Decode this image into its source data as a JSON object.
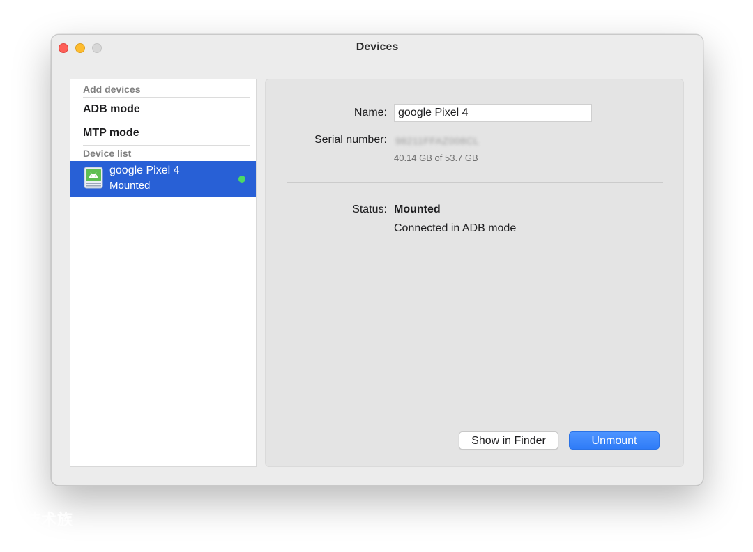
{
  "window": {
    "title": "Devices"
  },
  "sidebar": {
    "add_devices_header": "Add devices",
    "adb_mode_label": "ADB mode",
    "mtp_mode_label": "MTP mode",
    "device_list_header": "Device list",
    "devices": [
      {
        "name": "google Pixel 4",
        "status": "Mounted",
        "icon": "android-drive-icon",
        "online_color": "#4cd964",
        "selected": true
      }
    ]
  },
  "details": {
    "name_label": "Name:",
    "name_value": "google Pixel 4",
    "serial_label": "Serial number:",
    "serial_value": "98211FFAZ008CL",
    "storage_text": "40.14 GB of 53.7 GB",
    "status_label": "Status:",
    "status_value": "Mounted",
    "status_detail": "Connected in ADB mode"
  },
  "buttons": {
    "show_in_finder": "Show in Finder",
    "unmount": "Unmount"
  },
  "colors": {
    "selection": "#2860d6",
    "primary_button": "#2f7cf7",
    "close": "#fe5f57",
    "minimize": "#febc2e",
    "zoom_disabled": "#d7d7d7"
  },
  "watermark_text": "技术族"
}
